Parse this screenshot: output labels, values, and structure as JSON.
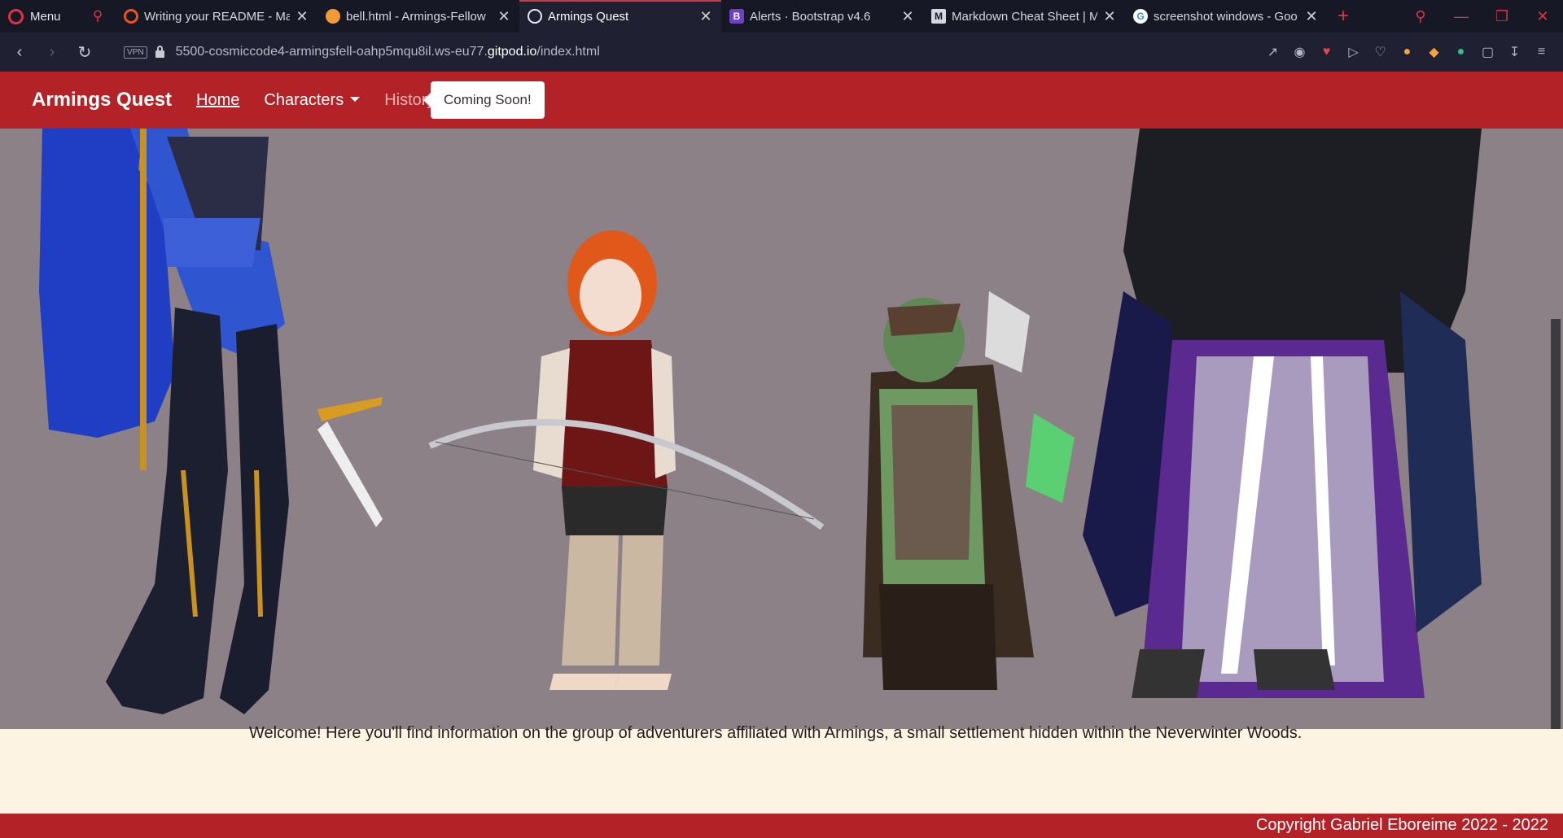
{
  "browser": {
    "menu_label": "Menu",
    "tabs": [
      {
        "title": "Writing your README - Ma",
        "icon": "opera-icon",
        "color": "#e8541f",
        "glyph": ""
      },
      {
        "title": "bell.html - Armings-Fellow",
        "icon": "gitpod-icon",
        "color": "#f29b36",
        "glyph": ""
      },
      {
        "title": "Armings Quest",
        "icon": "globe-icon",
        "color": "#e9eaf0",
        "glyph": ""
      },
      {
        "title": "Alerts · Bootstrap v4.6",
        "icon": "bootstrap-icon",
        "color": "#6f42c1",
        "glyph": "B"
      },
      {
        "title": "Markdown Cheat Sheet | M",
        "icon": "markdown-icon",
        "color": "#d6d7de",
        "glyph": "M"
      },
      {
        "title": "screenshot windows - Goo",
        "icon": "google-icon",
        "color": "#4285f4",
        "glyph": "G"
      }
    ],
    "vpn_label": "VPN",
    "url_prefix": "5500-cosmiccode4-armingsfell-oahp5mqu8il.ws-eu77.",
    "url_domain": "gitpod.io",
    "url_path": "/index.html"
  },
  "site": {
    "brand": "Armings Quest",
    "nav": {
      "home": "Home",
      "characters": "Characters",
      "history": "History"
    },
    "tooltip": "Coming Soon!",
    "hero_alt": "Four adventurers illustration",
    "welcome": "Welcome! Here you'll find information on the group of adventurers affiliated with Armings, a small settlement hidden within the Neverwinter Woods.",
    "copyright": "Copyright Gabriel Eboreime 2022 - 2022",
    "colors": {
      "navbar": "#b22227",
      "hero_bg": "#8b8186",
      "page_bg": "#fdf3e3"
    }
  }
}
